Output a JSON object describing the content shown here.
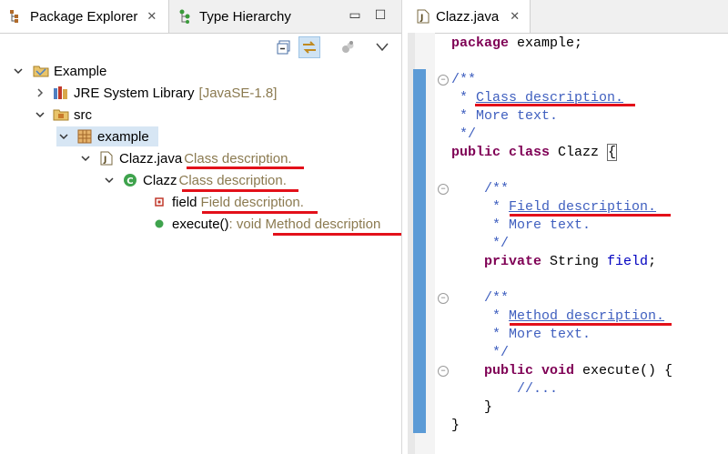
{
  "explorer": {
    "tabs": [
      {
        "label": "Package Explorer",
        "close": "✕"
      },
      {
        "label": "Type Hierarchy"
      }
    ],
    "window_buttons": {
      "minimize": "▭",
      "maximize": "☐"
    },
    "tree": {
      "project": "Example",
      "library": {
        "name": "JRE System Library",
        "decoration": "[JavaSE-1.8]"
      },
      "src": "src",
      "package": "example",
      "file": {
        "name": "Clazz.java",
        "decoration": "Class description."
      },
      "class": {
        "name": "Clazz",
        "decoration": "Class description."
      },
      "field": {
        "name": "field",
        "decoration": "Field description."
      },
      "method": {
        "name": "execute()",
        "decoration": " : void Method description"
      }
    }
  },
  "editor": {
    "tab": {
      "label": "Clazz.java",
      "close": "✕"
    },
    "code": {
      "package_kw": "package",
      "package_name": " example;",
      "c1_open": "/**",
      "c1_star": " * ",
      "c1_desc": "Class description.",
      "c1_more": " * More text.",
      "c1_close": " */",
      "class_kw": "public class",
      "class_name": " Clazz ",
      "brace_open": "{",
      "c2_open": "    /**",
      "c2_star": "     * ",
      "c2_desc": "Field description.",
      "c2_more": "     * More text.",
      "c2_close": "     */",
      "field_kw": "    private",
      "field_type": " String ",
      "field_name": "field",
      "field_end": ";",
      "c3_open": "    /**",
      "c3_star": "     * ",
      "c3_desc": "Method description.",
      "c3_more": "     * More text.",
      "c3_close": "     */",
      "method_kw": "    public void",
      "method_sig": " execute() {",
      "method_body": "        //...",
      "method_close": "    }",
      "brace_close": "}"
    }
  },
  "colors": {
    "keyword": "#7f0055",
    "javadoc": "#3f5fbf",
    "field": "#0000c0",
    "decoration": "#8b7a50",
    "annotation_underline": "#e3101a"
  }
}
